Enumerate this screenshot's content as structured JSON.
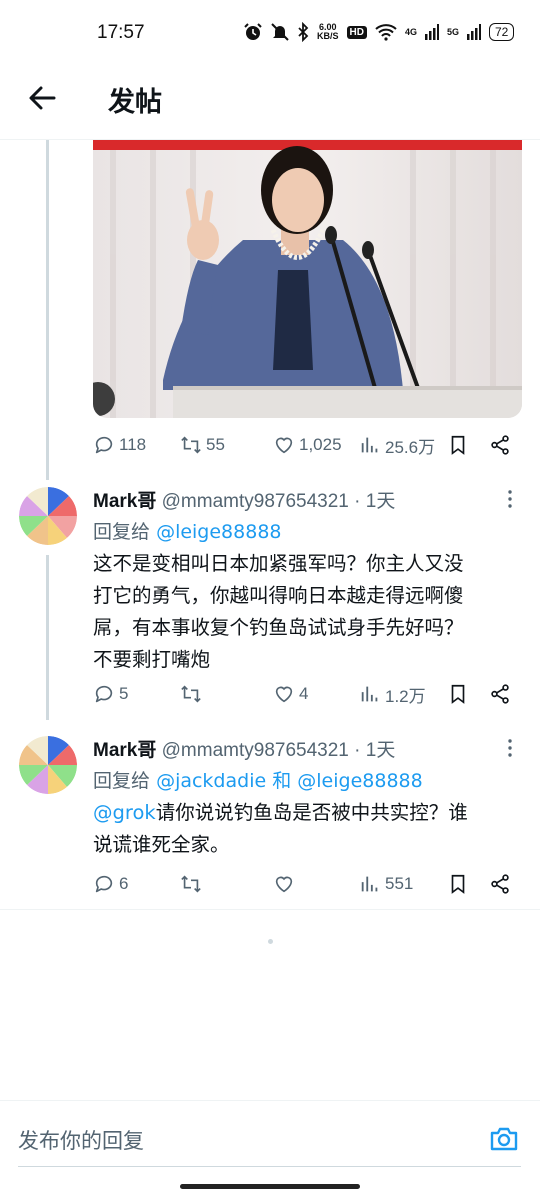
{
  "status_bar": {
    "time": "17:57",
    "net_speed_value": "6.00",
    "net_speed_unit": "KB/S",
    "hd_badge": "HD",
    "sig1": "4G",
    "sig2": "5G",
    "battery": "72"
  },
  "header": {
    "title": "发帖"
  },
  "original_post": {
    "image_description": "woman-giving-peace-sign-at-podium",
    "stats": {
      "replies": "118",
      "reposts": "55",
      "likes": "1,025",
      "views": "25.6万"
    }
  },
  "replies": [
    {
      "display_name": "Mark哥",
      "handle": "@mmamty987654321",
      "time": "· 1天",
      "reply_prefix": "回复给",
      "reply_mention_1": "@leige88888",
      "body_lines": [
        "这不是变相叫日本加紧强军吗？你主人又没",
        "打它的勇气，你越叫得响日本越走得远啊傻",
        "屌，有本事收复个钓鱼岛试试身手先好吗？",
        "不要剩打嘴炮"
      ],
      "stats": {
        "replies": "5",
        "reposts": "",
        "likes": "4",
        "views": "1.2万"
      }
    },
    {
      "display_name": "Mark哥",
      "handle": "@mmamty987654321",
      "time": "· 1天",
      "reply_prefix": "回复给",
      "reply_mention_1": "@jackdadie",
      "reply_joiner": "和",
      "reply_mention_2": "@leige88888",
      "body_mention": "@grok",
      "body_line1_rest": "请你说说钓鱼岛是否被中共实控？谁",
      "body_line2": "说谎谁死全家。",
      "stats": {
        "replies": "6",
        "reposts": "",
        "likes": "",
        "views": "551"
      }
    }
  ],
  "compose": {
    "placeholder": "发布你的回复"
  },
  "colors": {
    "accent": "#1d9bf0",
    "muted": "#536471",
    "text": "#0f1419",
    "thread_line": "#cfd9de"
  }
}
